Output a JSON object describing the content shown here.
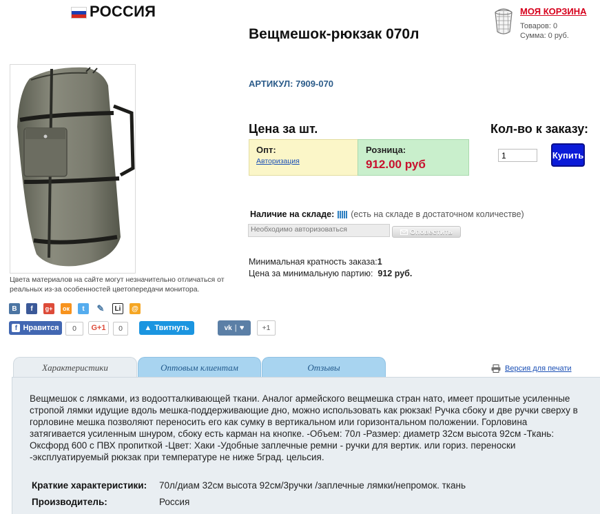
{
  "header": {
    "country": "РОССИЯ",
    "flag_colors": [
      "#ffffff",
      "#1c3fb3",
      "#d52b1e"
    ],
    "cart": {
      "title": "МОЯ КОРЗИНА",
      "items_line": "Товаров: 0",
      "sum_line": "Сумма: 0 руб.",
      "icon": "basket-icon"
    }
  },
  "product": {
    "title": "Вещмешок-рюкзак 070л",
    "article": "АРТИКУЛ: 7909-070",
    "photo_note": "Цвета материалов на сайте могут незначительно отличаться от реальных из-за особенностей цветопередачи монитора."
  },
  "pricing": {
    "price_heading": "Цена за шт.",
    "qty_heading": "Кол-во к заказу:",
    "wholesale_label": "Опт:",
    "wholesale_link": "Авторизация",
    "retail_label": "Розница:",
    "retail_price": "912.00 руб",
    "qty_value": "1",
    "buy_label": "Купить"
  },
  "stock": {
    "label": "Наличие на складе:",
    "text": "(есть на складе в достаточном количестве)",
    "auth_placeholder": "Необходимо авторизоваться",
    "notify_label": "Оповестить"
  },
  "order": {
    "min_multiplicity_label": "Минимальная кратность заказа:",
    "min_multiplicity_value": "1",
    "min_batch_label": "Цена за минимальную партию:",
    "min_batch_value": "912 руб."
  },
  "share": {
    "icons": [
      {
        "name": "vk-share-icon",
        "glyph": "В",
        "color": "#4c75a3"
      },
      {
        "name": "facebook-share-icon",
        "glyph": "f",
        "color": "#3b5998"
      },
      {
        "name": "google-plus-share-icon",
        "glyph": "g+",
        "color": "#dd4b39"
      },
      {
        "name": "odnoklassniki-share-icon",
        "glyph": "ок",
        "color": "#f7931e"
      },
      {
        "name": "twitter-share-icon",
        "glyph": "t",
        "color": "#55acee"
      },
      {
        "name": "livejournal-share-icon",
        "glyph": "✎",
        "color": "#4a7aa5"
      },
      {
        "name": "liveinternet-share-icon",
        "glyph": "Li",
        "color": "#222222"
      },
      {
        "name": "mail-share-icon",
        "glyph": "@",
        "color": "#f5a623"
      }
    ],
    "fb_like": "Нравится",
    "fb_count": "0",
    "gplus_label": "G+1",
    "gplus_count": "0",
    "tweet_label": "Твитнуть",
    "vk_count": "+1"
  },
  "tabs": [
    {
      "label": "Характеристики",
      "active": true
    },
    {
      "label": "Оптовым клиентам",
      "active": false
    },
    {
      "label": "Отзывы",
      "active": false
    }
  ],
  "print_label": "Версия для печати",
  "description": "Вещмешок с лямками, из водоотталкивающей ткани. Аналог армейского вещмешка стран нато, имеет прошитые усиленные стропой лямки идущие вдоль мешка-поддерживающие дно, можно использовать как рюкзак! Ручка сбоку и две ручки сверху в горловине мешка позволяют переносить его как сумку в вертикальном или горизонтальном положении. Горловина затягивается усиленным шнуром, сбоку есть карман на кнопке. -Объем: 70л -Размер: диаметр 32см высота 92см -Ткань: Оксфорд 600 с ПВХ пропиткой -Цвет: Хаки -Удобные заплечные ремни - ручки для вертик. или гориз. переноски -эксплуатируемый рюкзак при температуре не ниже 5град. цельсия.",
  "specs": [
    {
      "label": "Краткие характеристики:",
      "value": "70л/диам 32см высота 92см/3ручки /заплечные лямки/непромок. ткань"
    },
    {
      "label": "Производитель:",
      "value": "Россия"
    }
  ]
}
